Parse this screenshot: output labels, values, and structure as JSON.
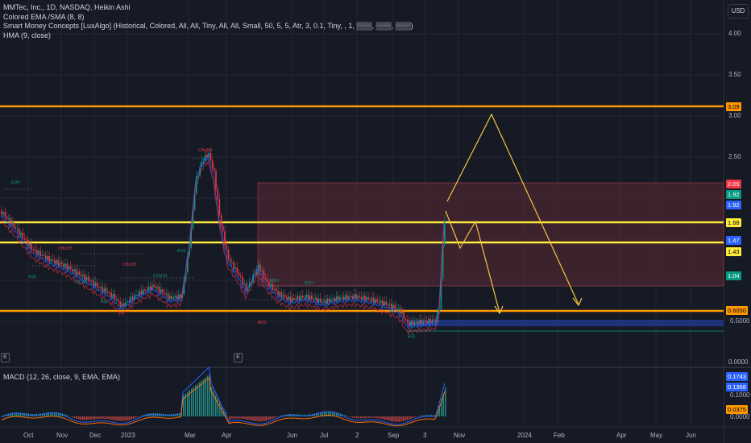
{
  "legend": {
    "title": "MMTec, Inc., 1D, NASDAQ, Heikin Ashi",
    "ind1": "Colored EMA /SMA (8, 8)",
    "ind2": "Smart Money Concepts [LuxAlgo] (Historical, Colored, All, All, Tiny, All, All, Small, 50, 5, 5, Atr, 3, 0.1, Tiny, , 1, ▒▒▒, ▒▒▒, ▒▒▒)",
    "ind3": "HMA (9, close)"
  },
  "currency": "USD",
  "price_scale": [
    "4.00",
    "3.50",
    "3.00",
    "2.50",
    "0.5000",
    "0.0000"
  ],
  "price_tags": [
    {
      "value": "3.09",
      "bg": "#ff9800",
      "fg": "#000000"
    },
    {
      "value": "2.05",
      "bg": "#f23645",
      "fg": "#ffffff"
    },
    {
      "value": "1.92",
      "bg": "#089981",
      "fg": "#ffffff"
    },
    {
      "value": "1.92",
      "bg": "#2962ff",
      "fg": "#ffffff"
    },
    {
      "value": "1.68",
      "bg": "#ffeb3b",
      "fg": "#000000"
    },
    {
      "value": "1.47",
      "bg": "#2962ff",
      "fg": "#ffffff"
    },
    {
      "value": "1.43",
      "bg": "#ffeb3b",
      "fg": "#000000"
    },
    {
      "value": "1.04",
      "bg": "#089981",
      "fg": "#ffffff"
    },
    {
      "value": "0.6050",
      "bg": "#ff9800",
      "fg": "#000000"
    }
  ],
  "macd": {
    "label": "MACD (12, 26, close, 9, EMA, EMA)",
    "scale": [
      "0.1000",
      "0.0000"
    ],
    "tags": [
      {
        "value": "0.1743",
        "bg": "#2962ff",
        "fg": "#ffffff"
      },
      {
        "value": "0.1368",
        "bg": "#2962ff",
        "fg": "#ffffff"
      },
      {
        "value": "0.0375",
        "bg": "#ff9800",
        "fg": "#000000"
      }
    ]
  },
  "time_axis": [
    "Oct",
    "Nov",
    "Dec",
    "2023",
    "Mar",
    "Apr",
    "Jun",
    "Jul",
    "2",
    "Sep",
    "3",
    "Nov",
    "2024",
    "Feb",
    "Apr",
    "May",
    "Jun"
  ],
  "smc_labels": [
    "EQH",
    "CHoCH",
    "BOS",
    "EQL",
    "CHoCH",
    "CHoCH",
    "BOS",
    "CHoCH",
    "EQH",
    "EQH",
    "BOS",
    "EQL",
    "EQL"
  ],
  "e_button": "E",
  "colors": {
    "background": "#161a25",
    "orange_level": "#ff9800",
    "yellow_level": "#ffeb3b",
    "bull": "#089981",
    "bear": "#f23645",
    "zone": "#5c2a33",
    "projection": "#f5c542"
  }
}
